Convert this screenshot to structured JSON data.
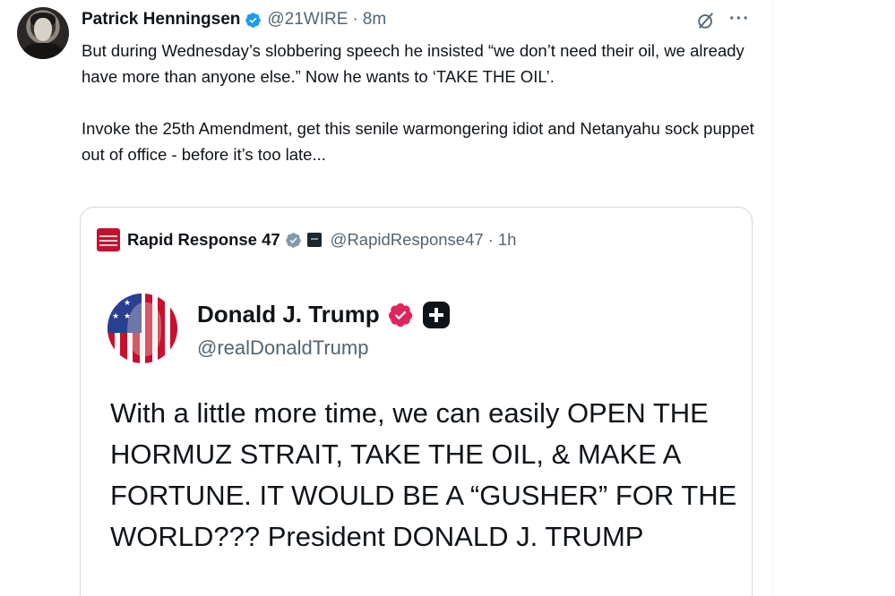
{
  "post": {
    "author_name": "Patrick Henningsen",
    "author_handle": "@21WIRE",
    "separator": "·",
    "time": "8m",
    "more_label": "···",
    "text_para1": "But during Wednesday’s slobbering speech he insisted “we don’t need their oil, we already have more than anyone else.” Now he wants to ‘TAKE THE OIL’.",
    "text_para2": "Invoke the 25th Amendment, get this senile warmongering idiot and Netanyahu sock puppet out of office - before it’s too late..."
  },
  "quote": {
    "author_name": "Rapid Response 47",
    "author_handle": "@RapidResponse47",
    "separator": "·",
    "time": "1h",
    "embedded": {
      "name": "Donald J. Trump",
      "handle": "@realDonaldTrump",
      "text": "With a little more time, we can easily OPEN THE HORMUZ STRAIT, TAKE THE OIL, & MAKE A FORTUNE. IT WOULD BE A “GUSHER” FOR THE WORLD??? President DONALD J. TRUMP"
    }
  },
  "icons": {
    "verified": "verified-badge-icon",
    "grok": "grok-icon",
    "more": "more-icon",
    "gray_check": "gray-verified-badge-icon",
    "gov": "government-badge-icon",
    "pink_check": "pink-verified-badge-icon",
    "truth_plus": "truth-social-plus-icon"
  },
  "colors": {
    "text": "#0f1419",
    "muted": "#536471",
    "border": "#cfd9de",
    "verified_blue": "#1d9bf0",
    "brand_red": "#c8102e",
    "pink_badge": "#e0245e"
  }
}
